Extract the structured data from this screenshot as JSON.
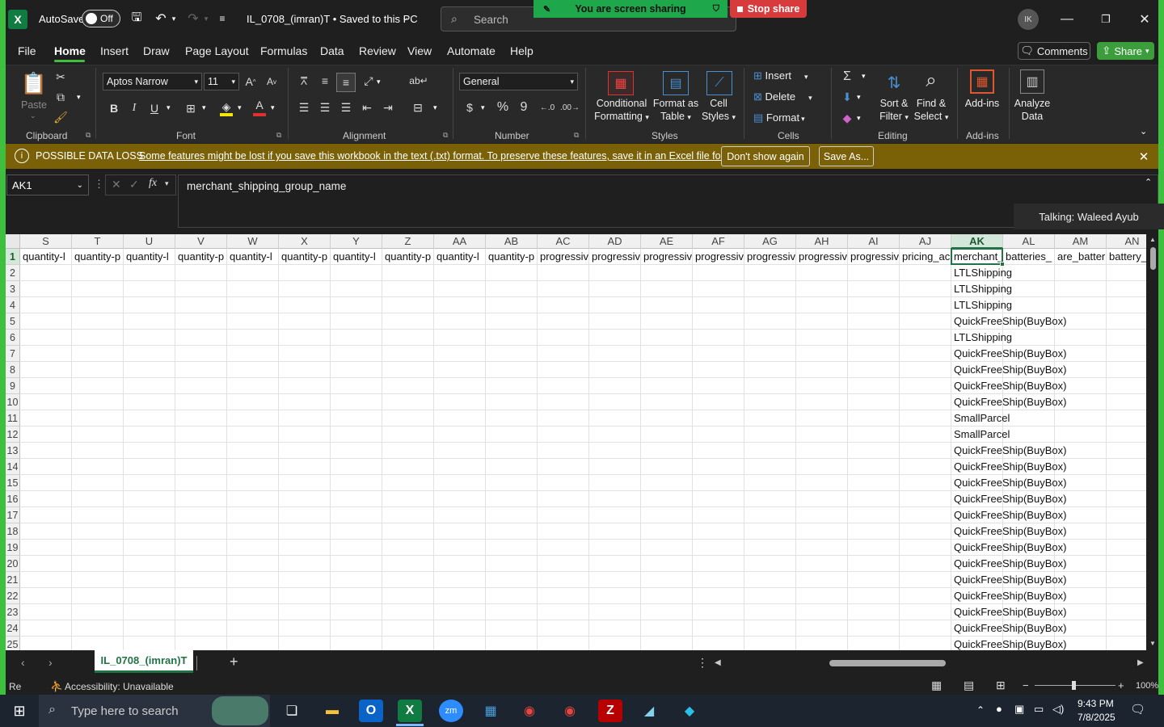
{
  "title": {
    "autosave_label": "AutoSave",
    "autosave_state": "Off",
    "file_name": "IL_0708_(imran)T • Saved to this PC",
    "search_placeholder": "Search",
    "share_banner": "You are screen sharing",
    "stop_share": "Stop share",
    "avatar_initials": "IK"
  },
  "menu": {
    "items": [
      "File",
      "Home",
      "Insert",
      "Draw",
      "Page Layout",
      "Formulas",
      "Data",
      "Review",
      "View",
      "Automate",
      "Help"
    ],
    "active": "Home",
    "comments": "Comments",
    "share": "Share"
  },
  "ribbon": {
    "clipboard": {
      "paste": "Paste",
      "label": "Clipboard"
    },
    "font": {
      "name": "Aptos Narrow",
      "size": "11",
      "label": "Font"
    },
    "alignment": {
      "label": "Alignment"
    },
    "number": {
      "format": "General",
      "label": "Number"
    },
    "styles": {
      "conditional": "Conditional Formatting",
      "format_table": "Format as Table",
      "cell_styles": "Cell Styles",
      "label": "Styles"
    },
    "cells": {
      "insert": "Insert",
      "delete": "Delete",
      "format": "Format",
      "label": "Cells"
    },
    "editing": {
      "sort": "Sort & Filter",
      "find": "Find & Select",
      "label": "Editing"
    },
    "addins": {
      "addins": "Add-ins",
      "label": "Add-ins",
      "analyze": "Analyze Data"
    }
  },
  "infobar": {
    "title": "POSSIBLE DATA LOSS",
    "message": "Some features might be lost if you save this workbook in the text (.txt) format. To preserve these features, save it in an Excel file format.",
    "dont_show": "Don't show again",
    "save_as": "Save As..."
  },
  "formula_bar": {
    "name_box": "AK1",
    "fx": "fx",
    "value": "merchant_shipping_group_name"
  },
  "talking": "Talking: Waleed Ayub",
  "sheet": {
    "columns": [
      "S",
      "T",
      "U",
      "V",
      "W",
      "X",
      "Y",
      "Z",
      "AA",
      "AB",
      "AC",
      "AD",
      "AE",
      "AF",
      "AG",
      "AH",
      "AI",
      "AJ",
      "AK",
      "AL",
      "AM",
      "AN"
    ],
    "selected_column": "AK",
    "row1": [
      "quantity-l",
      "quantity-p",
      "quantity-l",
      "quantity-p",
      "quantity-l",
      "quantity-p",
      "quantity-l",
      "quantity-p",
      "quantity-l",
      "quantity-p",
      "progressiv",
      "progressiv",
      "progressiv",
      "progressiv",
      "progressiv",
      "progressiv",
      "progressiv",
      "pricing_ac",
      "merchant_",
      "batteries_",
      "are_batter",
      "battery_"
    ],
    "rows": [
      "1",
      "2",
      "3",
      "4",
      "5",
      "6",
      "7",
      "8",
      "9",
      "10",
      "11",
      "12",
      "13",
      "14",
      "15",
      "16",
      "17",
      "18",
      "19",
      "20",
      "21",
      "22",
      "23",
      "24",
      "25"
    ],
    "ak_values": [
      "LTLShipping",
      "LTLShipping",
      "LTLShipping",
      "QuickFreeShip(BuyBox)",
      "LTLShipping",
      "QuickFreeShip(BuyBox)",
      "QuickFreeShip(BuyBox)",
      "QuickFreeShip(BuyBox)",
      "QuickFreeShip(BuyBox)",
      "SmallParcel",
      "SmallParcel",
      "QuickFreeShip(BuyBox)",
      "QuickFreeShip(BuyBox)",
      "QuickFreeShip(BuyBox)",
      "QuickFreeShip(BuyBox)",
      "QuickFreeShip(BuyBox)",
      "QuickFreeShip(BuyBox)",
      "QuickFreeShip(BuyBox)",
      "QuickFreeShip(BuyBox)",
      "QuickFreeShip(BuyBox)",
      "QuickFreeShip(BuyBox)",
      "QuickFreeShip(BuyBox)",
      "QuickFreeShip(BuyBox)",
      "QuickFreeShip(BuyBox)"
    ],
    "tab_name": "IL_0708_(imran)T"
  },
  "status": {
    "ready": "Re",
    "accessibility": "Accessibility: Unavailable",
    "zoom": "100%"
  },
  "taskbar": {
    "search_placeholder": "Type here to search",
    "time": "9:43 PM",
    "date": "7/8/2025"
  }
}
